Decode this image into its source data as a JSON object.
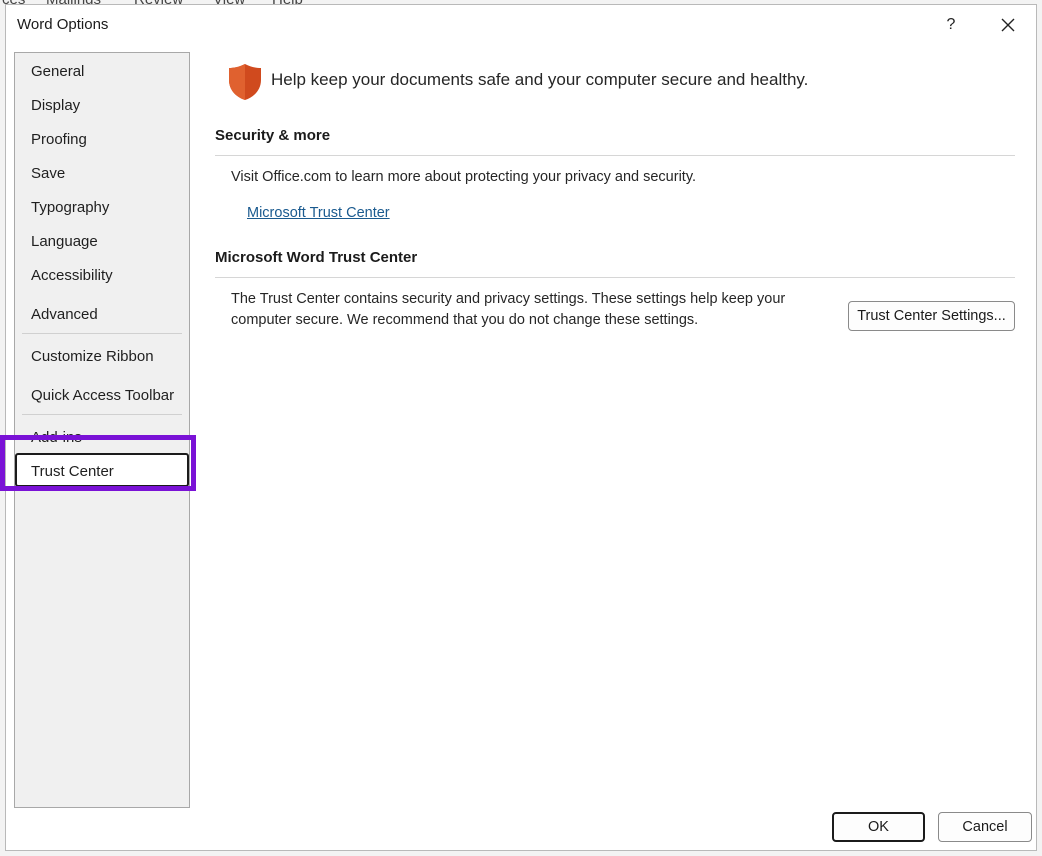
{
  "background_tabs": [
    "ces",
    "Mailings",
    "Review",
    "View",
    "Help"
  ],
  "dialog": {
    "title": "Word Options",
    "help_label": "?",
    "close_label": "✕"
  },
  "nav": {
    "items": [
      {
        "label": "General"
      },
      {
        "label": "Display"
      },
      {
        "label": "Proofing"
      },
      {
        "label": "Save"
      },
      {
        "label": "Typography"
      },
      {
        "label": "Language"
      },
      {
        "label": "Accessibility"
      },
      {
        "label": "Advanced"
      },
      {
        "label": "Customize Ribbon"
      },
      {
        "label": "Quick Access Toolbar"
      },
      {
        "label": "Add-ins"
      },
      {
        "label": "Trust Center",
        "selected": true
      }
    ],
    "highlight_color": "#7a12d6"
  },
  "main": {
    "shield_icon": "shield-icon",
    "shield_color": "#d04a1e",
    "headline": "Help keep your documents safe and your computer secure and healthy.",
    "security": {
      "heading": "Security & more",
      "text": "Visit Office.com to learn more about protecting your privacy and security.",
      "link": "Microsoft Trust Center"
    },
    "trust_center": {
      "heading": "Microsoft Word Trust Center",
      "text_line1": "The Trust Center contains security and privacy settings. These settings help keep your",
      "text_line2": "computer secure. We recommend that you do not change these settings.",
      "button": "Trust Center Settings..."
    }
  },
  "footer": {
    "ok": "OK",
    "cancel": "Cancel"
  }
}
